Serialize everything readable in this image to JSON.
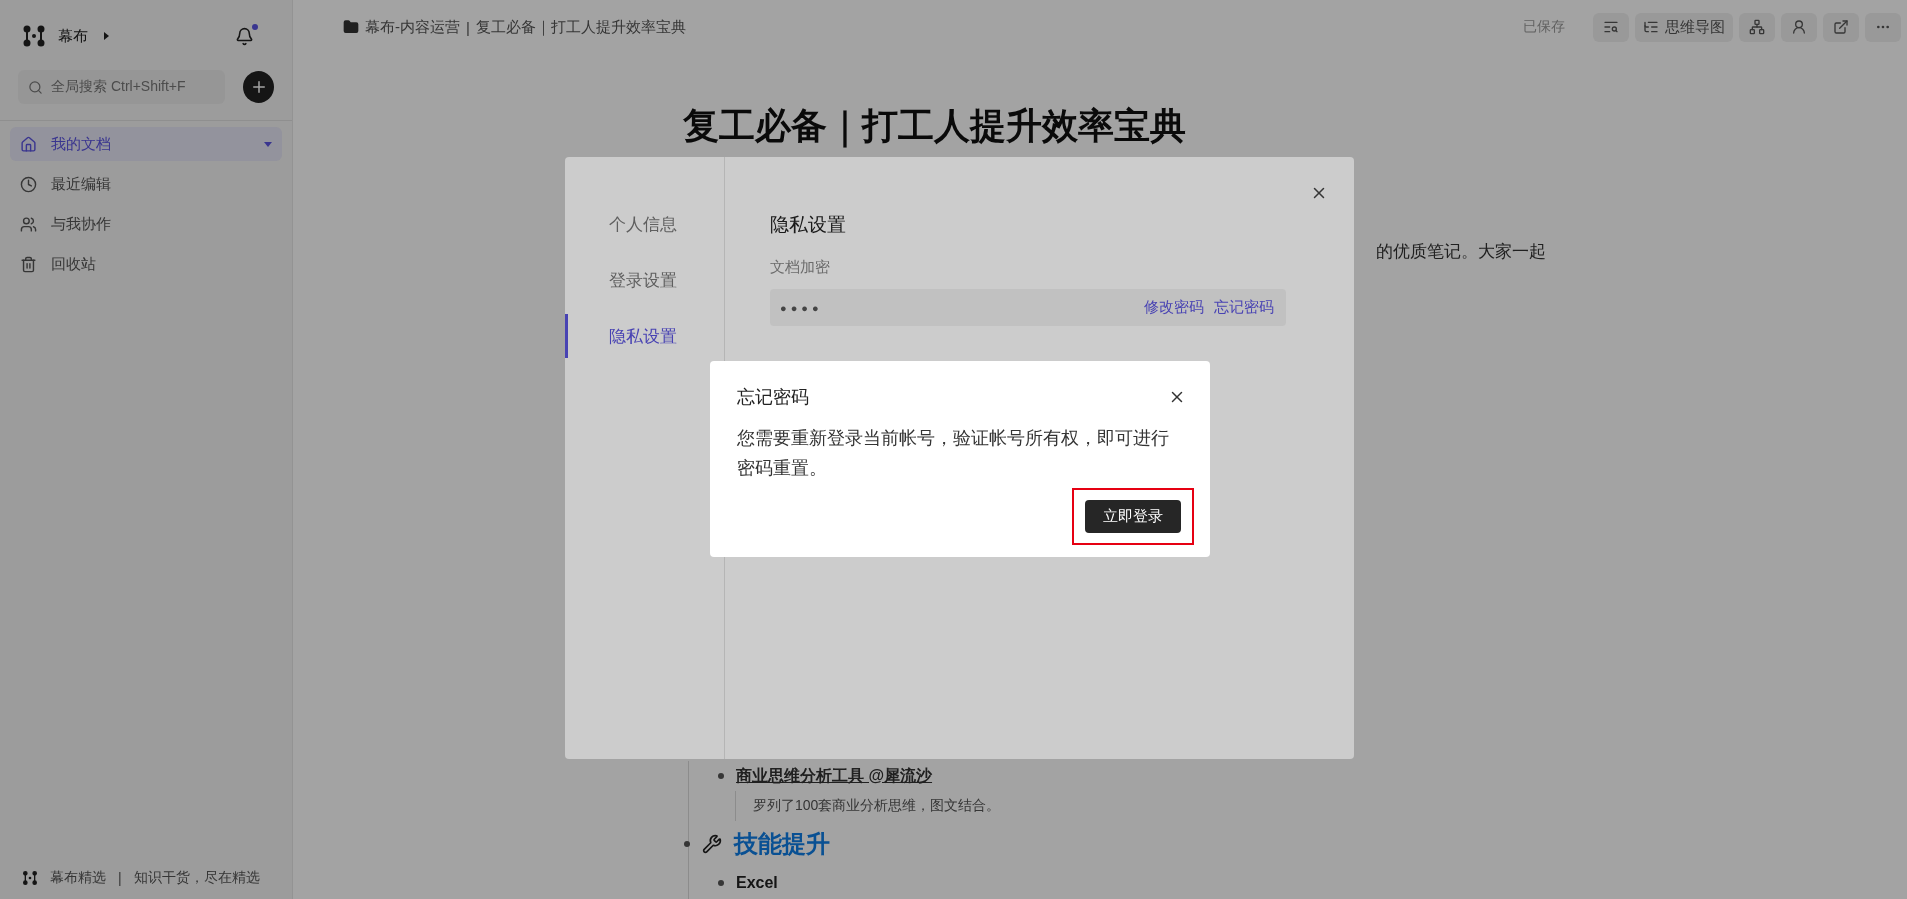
{
  "sidebar": {
    "brand": "幕布",
    "has_unread": true,
    "search": {
      "placeholder": "全局搜索 Ctrl+Shift+F"
    },
    "nav": [
      {
        "label": "我的文档",
        "selected": true
      },
      {
        "label": "最近编辑",
        "selected": false
      },
      {
        "label": "与我协作",
        "selected": false
      },
      {
        "label": "回收站",
        "selected": false
      }
    ],
    "footer": {
      "brand": "幕布精选",
      "separator": "|",
      "slogan": "知识干货，尽在精选"
    }
  },
  "topbar": {
    "breadcrumb": [
      "幕布-内容运营",
      "复工必备｜打工人提升效率宝典"
    ],
    "separator": "|",
    "status": "已保存",
    "mindmap_button": "思维导图"
  },
  "document": {
    "title": "复工必备｜打工人提升效率宝典",
    "paragraph_fragment": "的优质笔记。大家一起",
    "items": [
      {
        "kind": "link",
        "text": "商业思维分析工具 @犀流沙",
        "note": "罗列了100套商业分析思维，图文结合。"
      },
      {
        "kind": "heading",
        "text": "技能提升"
      },
      {
        "kind": "bold",
        "text": "Excel"
      }
    ]
  },
  "settings_modal": {
    "tabs": [
      {
        "label": "个人信息",
        "selected": false
      },
      {
        "label": "登录设置",
        "selected": false
      },
      {
        "label": "隐私设置",
        "selected": true
      }
    ],
    "heading": "隐私设置",
    "field_label": "文档加密",
    "password_mask": "●●●●",
    "links": [
      "修改密码",
      "忘记密码"
    ]
  },
  "dialog": {
    "title": "忘记密码",
    "message": "您需要重新登录当前帐号，验证帐号所有权，即可进行密码重置。",
    "button": "立即登录",
    "button_highlighted": true
  }
}
